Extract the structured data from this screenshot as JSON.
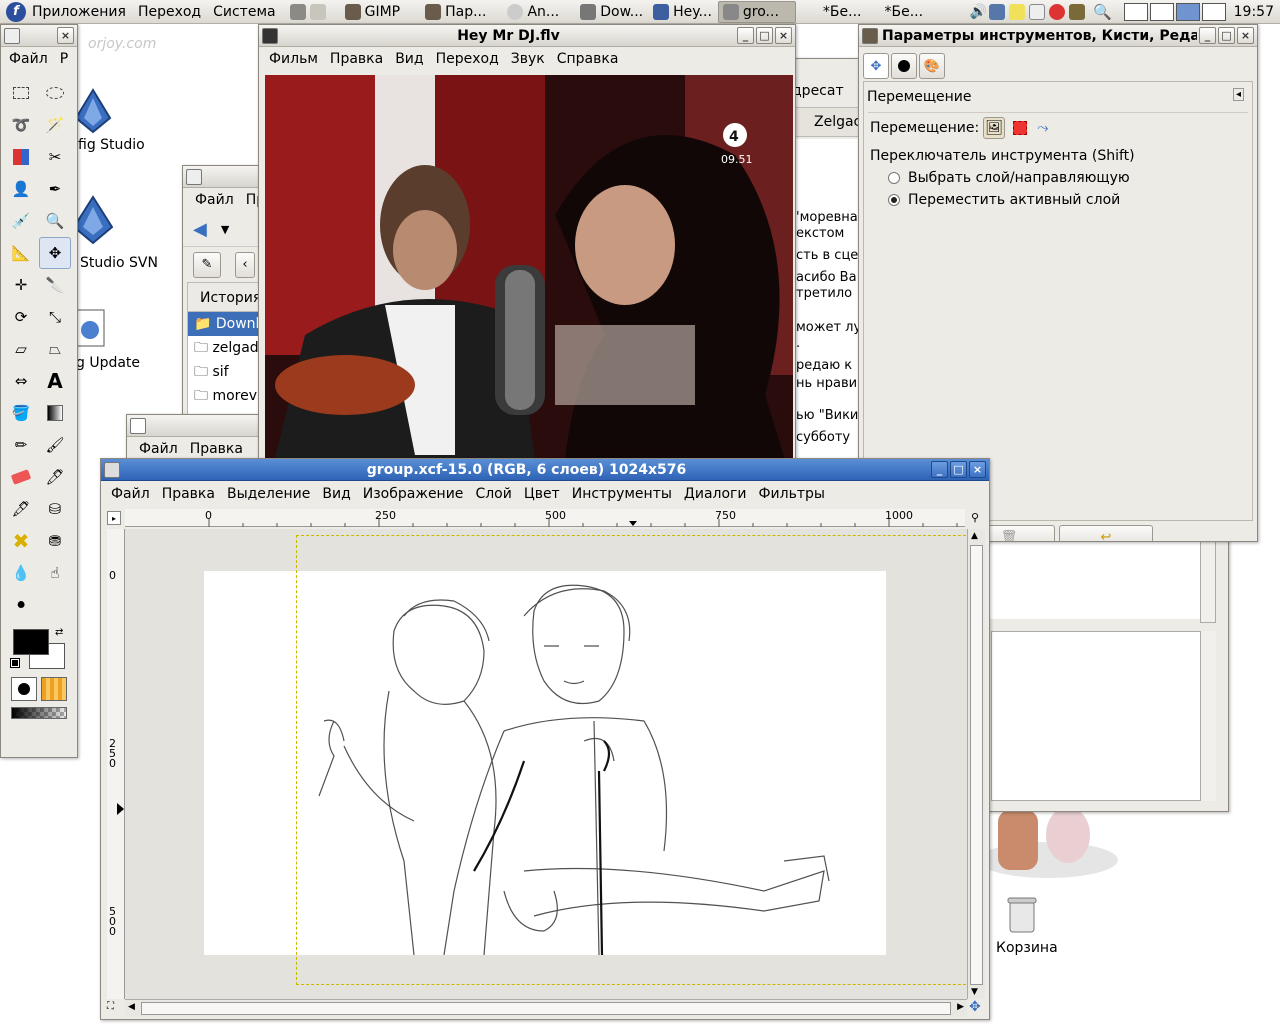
{
  "panel": {
    "menus": [
      "Приложения",
      "Переход",
      "Система"
    ],
    "tasks": [
      {
        "label": "GIMP",
        "active": false
      },
      {
        "label": "Пар...",
        "active": false
      },
      {
        "label": "An...",
        "active": false
      },
      {
        "label": "Dow...",
        "active": false
      },
      {
        "label": "Hey...",
        "active": false
      },
      {
        "label": "gro...",
        "active": true
      },
      {
        "label": "*Бе...",
        "active": false
      },
      {
        "label": "*Бе...",
        "active": false
      }
    ],
    "clock": "19:57"
  },
  "desktop": {
    "watermark": "orjoy.com",
    "icons": [
      {
        "label": "fig Studio",
        "icon": "synfig-studio-icon"
      },
      {
        "label": "Studio SVN",
        "icon": "synfig-svn-icon"
      },
      {
        "label": "g Update",
        "icon": "software-update-icon"
      },
      {
        "label": "Корзина",
        "icon": "trash-icon"
      }
    ]
  },
  "toolbox": {
    "menu": [
      "Файл",
      "Р"
    ],
    "tools": [
      "rect-select-tool",
      "ellipse-select-tool",
      "free-select-tool",
      "fuzzy-select-tool",
      "color-select-tool",
      "scissors-tool",
      "foreground-select-tool",
      "paths-tool",
      "color-picker-tool",
      "zoom-tool",
      "measure-tool",
      "move-tool",
      "align-tool",
      "crop-tool",
      "rotate-tool",
      "scale-tool",
      "shear-tool",
      "perspective-tool",
      "flip-tool",
      "text-tool",
      "bucket-fill-tool",
      "blend-tool",
      "pencil-tool",
      "paintbrush-tool",
      "eraser-tool",
      "airbrush-tool",
      "ink-tool",
      "clone-tool",
      "heal-tool",
      "perspective-clone-tool",
      "blur-tool",
      "smudge-tool",
      "dodge-burn-tool"
    ],
    "selected": "move-tool",
    "fg": "#000000",
    "bg": "#ffffff"
  },
  "nautilus": {
    "menu": [
      "Файл",
      "Пр"
    ],
    "history_label": "История",
    "items": [
      {
        "label": "Downlo",
        "selected": true
      },
      {
        "label": "zelgadis",
        "selected": false
      },
      {
        "label": "sif",
        "selected": false
      },
      {
        "label": "morevn",
        "selected": false
      }
    ]
  },
  "win_behind": {
    "menu": [
      "Файл",
      "Правка"
    ]
  },
  "browser": {
    "tab_text": "дресат",
    "tab2": "Zelgac",
    "lines": [
      "'моревна",
      "екстом",
      "сть в сце",
      "асибо Ва",
      "третило",
      "может лу",
      ".",
      "редаю к",
      "нь нрави",
      "ью \"Вики",
      "субботу"
    ]
  },
  "player": {
    "title": "Hey Mr DJ.flv",
    "menu": [
      "Фильм",
      "Правка",
      "Вид",
      "Переход",
      "Звук",
      "Справка"
    ],
    "channel": "4",
    "time": "09.51"
  },
  "tooloptions": {
    "title": "Параметры инструментов, Кисти, Реда",
    "tool_name": "Перемещение",
    "move_label": "Перемещение:",
    "switch_label": "Переключатель инструмента  (Shift)",
    "options": [
      {
        "label": "Выбрать слой/направляющую",
        "checked": false
      },
      {
        "label": "Переместить активный слой",
        "checked": true
      }
    ]
  },
  "gimp": {
    "title": "group.xcf-15.0 (RGB, 6 слоев) 1024x576",
    "menu": [
      "Файл",
      "Правка",
      "Выделение",
      "Вид",
      "Изображение",
      "Слой",
      "Цвет",
      "Инструменты",
      "Диалоги",
      "Фильтры"
    ],
    "hruler": [
      "0",
      "250",
      "500",
      "750",
      "1000"
    ],
    "vruler": [
      "0",
      "250",
      "500"
    ]
  }
}
